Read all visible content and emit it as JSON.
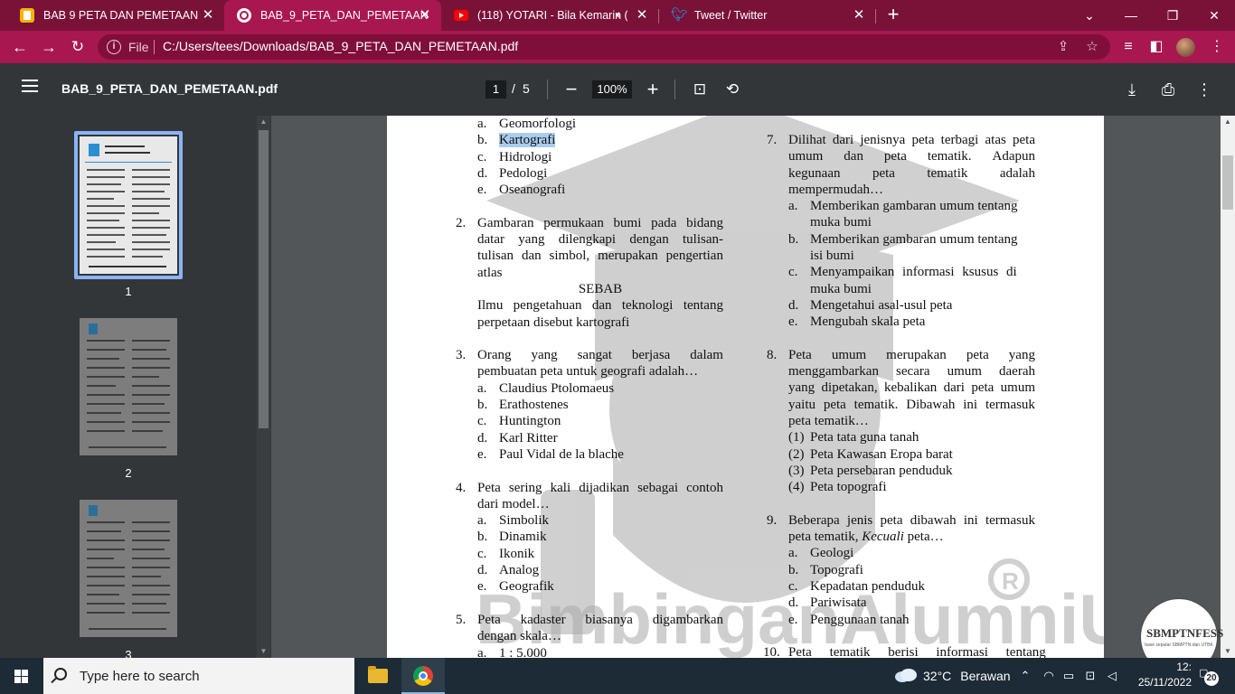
{
  "browser": {
    "tabs": [
      {
        "title": "BAB 9 PETA DAN PEMETAAN",
        "active": false,
        "favicon": "yellow-doc-icon"
      },
      {
        "title": "BAB_9_PETA_DAN_PEMETAAN.pd",
        "active": true,
        "favicon": "globe-icon"
      },
      {
        "title": "(118) YOTARI - Bila Kemarin (",
        "active": false,
        "favicon": "youtube-icon"
      },
      {
        "title": "Tweet / Twitter",
        "active": false,
        "favicon": "twitter-icon"
      }
    ],
    "address": {
      "scheme_label": "File",
      "url": "C:/Users/tees/Downloads/BAB_9_PETA_DAN_PEMETAAN.pdf"
    },
    "colors": {
      "frame": "#7a1238",
      "active_tab": "#a8174f"
    }
  },
  "pdf_toolbar": {
    "filename": "BAB_9_PETA_DAN_PEMETAAN.pdf",
    "current_page": "1",
    "page_separator": "/",
    "total_pages": "5",
    "zoom": "100%"
  },
  "thumbnails": [
    {
      "label": "1",
      "selected": true
    },
    {
      "label": "2",
      "selected": false
    },
    {
      "label": "3",
      "selected": false
    }
  ],
  "document": {
    "left": {
      "q1_options": [
        {
          "mark": "a.",
          "text": "Geomorfologi"
        },
        {
          "mark": "b.",
          "text": "Kartografi"
        },
        {
          "mark": "c.",
          "text": "Hidrologi"
        },
        {
          "mark": "d.",
          "text": "Pedologi"
        },
        {
          "mark": "e.",
          "text": "Oseanografi"
        }
      ],
      "q2": {
        "num": "2.",
        "lines": [
          "Gambaran permukaan bumi pada bidang",
          "datar yang dilengkapi dengan tulisan-",
          "tulisan dan simbol, merupakan pengertian",
          "atlas"
        ],
        "center": "SEBAB",
        "lines2": [
          "Ilmu pengetahuan dan teknologi tentang",
          "perpetaan disebut kartografi"
        ]
      },
      "q3": {
        "num": "3.",
        "lines": [
          "Orang yang sangat berjasa dalam",
          "pembuatan peta untuk geografi adalah…"
        ],
        "options": [
          {
            "mark": "a.",
            "text": "Claudius Ptolomaeus"
          },
          {
            "mark": "b.",
            "text": "Erathostenes"
          },
          {
            "mark": "c.",
            "text": "Huntington"
          },
          {
            "mark": "d.",
            "text": "Karl Ritter"
          },
          {
            "mark": "e.",
            "text": "Paul Vidal de la blache"
          }
        ]
      },
      "q4": {
        "num": "4.",
        "lines": [
          "Peta sering kali dijadikan sebagai contoh",
          "dari model…"
        ],
        "options": [
          {
            "mark": "a.",
            "text": "Simbolik"
          },
          {
            "mark": "b.",
            "text": "Dinamik"
          },
          {
            "mark": "c.",
            "text": "Ikonik"
          },
          {
            "mark": "d.",
            "text": "Analog"
          },
          {
            "mark": "e.",
            "text": "Geografik"
          }
        ]
      },
      "q5": {
        "num": "5.",
        "lines": [
          "Peta kadaster biasanya digambarkan",
          "dengan skala…"
        ],
        "options": [
          {
            "mark": "a.",
            "text": "1 : 5.000"
          }
        ]
      }
    },
    "right": {
      "q7": {
        "num": "7.",
        "lines": [
          "Dilihat dari jenisnya peta terbagi atas peta",
          "umum dan peta tematik. Adapun",
          "kegunaan peta tematik adalah",
          "mempermudah…"
        ],
        "options": [
          {
            "mark": "a.",
            "lines": [
              "Memberikan gambaran umum tentang",
              "muka bumi"
            ]
          },
          {
            "mark": "b.",
            "lines": [
              "Memberikan gambaran umum tentang",
              "isi bumi"
            ]
          },
          {
            "mark": "c.",
            "lines": [
              "Menyampaikan informasi ksusus di",
              "muka bumi"
            ]
          },
          {
            "mark": "d.",
            "lines": [
              "Mengetahui asal-usul peta"
            ]
          },
          {
            "mark": "e.",
            "lines": [
              "Mengubah skala peta"
            ]
          }
        ]
      },
      "q8": {
        "num": "8.",
        "lines": [
          "Peta umum merupakan peta yang",
          "menggambarkan secara umum daerah",
          "yang dipetakan, kebalikan dari peta umum",
          "yaitu peta tematik. Dibawah ini termasuk",
          "peta tematik…"
        ],
        "items": [
          {
            "mark": "(1)",
            "text": "Peta tata guna tanah"
          },
          {
            "mark": "(2)",
            "text": "Peta Kawasan Eropa barat"
          },
          {
            "mark": "(3)",
            "text": "Peta persebaran penduduk"
          },
          {
            "mark": "(4)",
            "text": "Peta topografi"
          }
        ]
      },
      "q9": {
        "num": "9.",
        "line1": "Beberapa jenis peta dibawah ini termasuk",
        "line2_pre": "peta tematik, ",
        "line2_em": "Kecuali",
        "line2_post": " peta…",
        "options": [
          {
            "mark": "a.",
            "text": "Geologi"
          },
          {
            "mark": "b.",
            "text": "Topografi"
          },
          {
            "mark": "c.",
            "text": "Kepadatan penduduk"
          },
          {
            "mark": "d.",
            "text": "Pariwisata"
          },
          {
            "mark": "e.",
            "text": "Penggunaan tanah"
          }
        ]
      },
      "q10": {
        "num": "10.",
        "line": "Peta tematik berisi informasi tentang"
      }
    },
    "watermark": "BimbinganAlumniUI"
  },
  "badge": {
    "title": "SBMPTNFESS",
    "subtitle": "base seputar SBMPTN dan UTBK"
  },
  "taskbar": {
    "search_placeholder": "Type here to search",
    "weather_temp": "32°C",
    "weather_text": "Berawan",
    "time": "12:",
    "date": "25/11/2022",
    "notification_count": "20"
  }
}
